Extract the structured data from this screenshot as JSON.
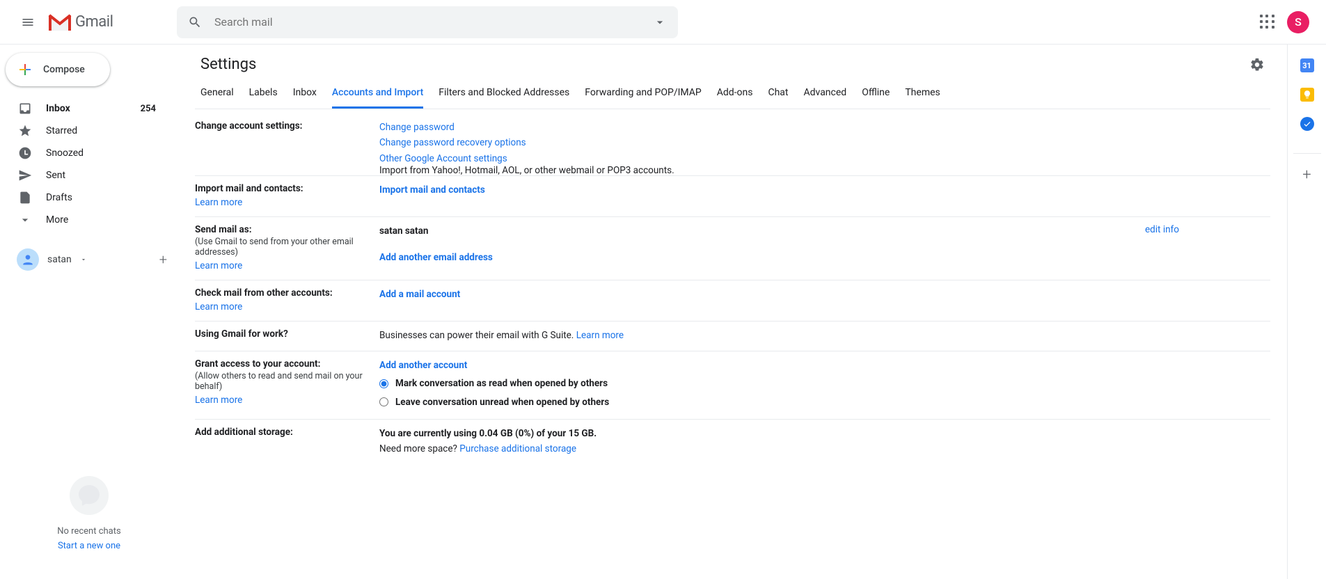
{
  "header": {
    "app_name": "Gmail",
    "search_placeholder": "Search mail",
    "avatar_letter": "S"
  },
  "sidebar": {
    "compose_label": "Compose",
    "items": [
      {
        "label": "Inbox",
        "count": "254",
        "active": true
      },
      {
        "label": "Starred"
      },
      {
        "label": "Snoozed"
      },
      {
        "label": "Sent"
      },
      {
        "label": "Drafts"
      },
      {
        "label": "More"
      }
    ],
    "chat": {
      "name": "satan"
    },
    "hangouts": {
      "no_chats": "No recent chats",
      "start_new": "Start a new one"
    }
  },
  "settings": {
    "title": "Settings",
    "tabs": [
      "General",
      "Labels",
      "Inbox",
      "Accounts and Import",
      "Filters and Blocked Addresses",
      "Forwarding and POP/IMAP",
      "Add-ons",
      "Chat",
      "Advanced",
      "Offline",
      "Themes"
    ],
    "active_tab_index": 3,
    "rows": {
      "change_account": {
        "title": "Change account settings:",
        "links": [
          "Change password",
          "Change password recovery options",
          "Other Google Account settings"
        ]
      },
      "import_mail": {
        "title": "Import mail and contacts:",
        "learn": "Learn more",
        "desc": "Import from Yahoo!, Hotmail, AOL, or other webmail or POP3 accounts.",
        "action": "Import mail and contacts"
      },
      "send_as": {
        "title": "Send mail as:",
        "sub": "(Use Gmail to send from your other email addresses)",
        "learn": "Learn more",
        "value": "satan satan",
        "action": "Add another email address",
        "edit": "edit info"
      },
      "check_mail": {
        "title": "Check mail from other accounts:",
        "learn": "Learn more",
        "action": "Add a mail account"
      },
      "gsuite": {
        "title": "Using Gmail for work?",
        "desc": "Businesses can power their email with G Suite. ",
        "learn": "Learn more"
      },
      "grant_access": {
        "title": "Grant access to your account:",
        "sub": "(Allow others to read and send mail on your behalf)",
        "learn": "Learn more",
        "action": "Add another account",
        "radio1": "Mark conversation as read when opened by others",
        "radio2": "Leave conversation unread when opened by others"
      },
      "storage": {
        "title": "Add additional storage:",
        "line1": "You are currently using 0.04 GB (0%) of your 15 GB.",
        "line2": "Need more space? ",
        "link": "Purchase additional storage"
      }
    }
  },
  "right_panel": {
    "cal": "31"
  }
}
